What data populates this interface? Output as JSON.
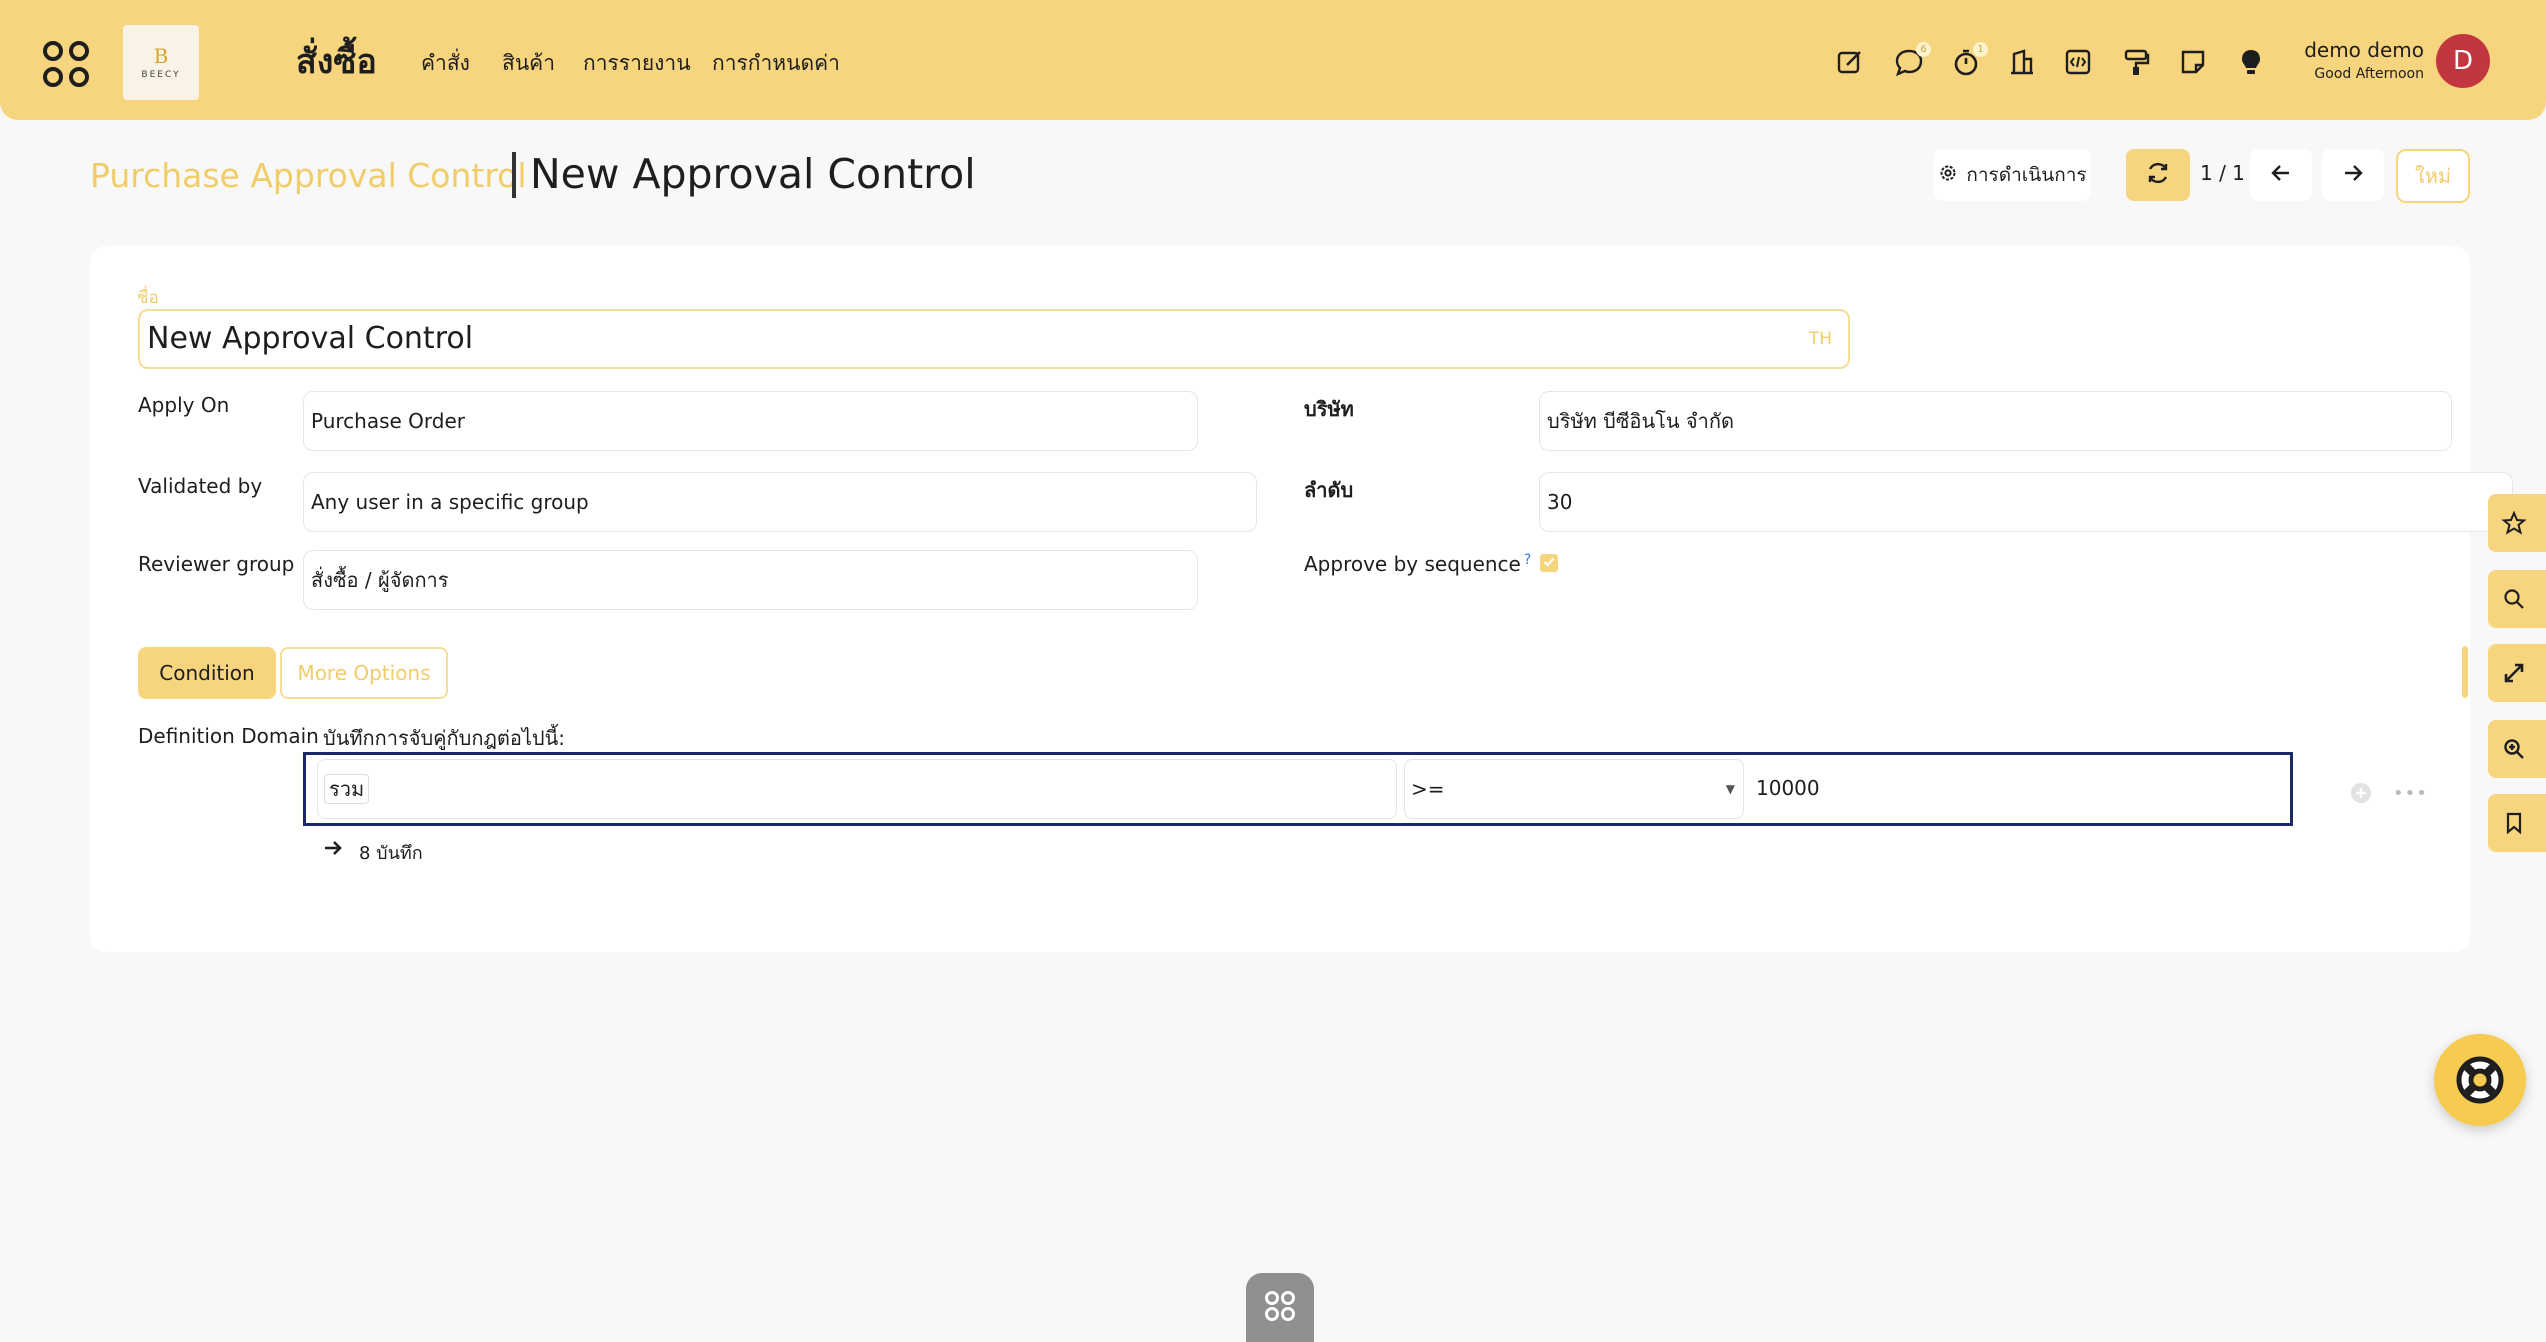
{
  "navbar": {
    "app_title": "สั่งซื้อ",
    "logo_mark": "B",
    "logo_word": "BEECY",
    "menu": [
      "คำสั่ง",
      "สินค้า",
      "การรายงาน",
      "การกำหนดค่า"
    ],
    "messages_badge": "6",
    "activities_badge": "1",
    "user_name": "demo demo",
    "user_greeting": "Good Afternoon",
    "avatar_letter": "D"
  },
  "control": {
    "breadcrumb_parent": "Purchase Approval Control",
    "breadcrumb_current": "New Approval Control",
    "actions_label": "การดำเนินการ",
    "pager": "1 / 1",
    "new_label": "ใหม่"
  },
  "form": {
    "name_label": "ชื่อ",
    "name_value": "New Approval Control",
    "name_lang": "TH",
    "apply_on_label": "Apply On",
    "apply_on_value": "Purchase Order",
    "validated_by_label": "Validated by",
    "validated_by_value": "Any user in a specific group",
    "reviewer_group_label": "Reviewer group",
    "reviewer_group_value": "สั่งซื้อ / ผู้จัดการ",
    "company_label": "บริษัท",
    "company_value": "บริษัท บีซีอินโน จำกัด",
    "sequence_label": "ลำดับ",
    "sequence_value": "30",
    "approve_by_sequence_label": "Approve by sequence",
    "approve_by_sequence_tooltip": "?",
    "approve_by_sequence_checked": true
  },
  "tabs": [
    {
      "label": "Condition",
      "active": true
    },
    {
      "label": "More Options",
      "active": false
    }
  ],
  "domain": {
    "label": "Definition Domain",
    "intro": "บันทึกการจับคู่กับกฎต่อไปนี้:",
    "rule": {
      "field": "รวม",
      "operator": ">=",
      "value": "10000"
    },
    "records_label": "8 บันทึก"
  },
  "colors": {
    "brand": "#f6d57e",
    "accent_text": "#f1cd69",
    "avatar": "#c2373f",
    "domain_border": "#1b2a66"
  },
  "icons": {
    "apps": "apps-icon",
    "edit": "edit-note-icon",
    "messages": "chat-icon",
    "activities": "clock-icon",
    "company": "building-icon",
    "debug": "code-icon",
    "theme": "paint-roller-icon",
    "notes": "sticky-note-icon",
    "tips": "lightbulb-icon",
    "rail": [
      "star-icon",
      "search-icon",
      "expand-icon",
      "zoom-in-icon",
      "bookmark-icon"
    ],
    "help": "lifebuoy-icon",
    "home": "apps-icon"
  }
}
